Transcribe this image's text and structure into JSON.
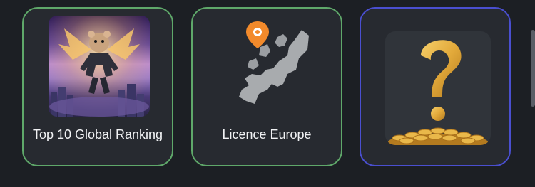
{
  "cards": [
    {
      "label": "Top 10 Global Ranking",
      "image": "hamster-astronaut-illustration",
      "border_color": "#5fa86a"
    },
    {
      "label": "Licence Europe",
      "image": "europe-map-with-pin",
      "border_color": "#5fa86a"
    },
    {
      "label": "",
      "image": "question-mark-with-coins",
      "border_color": "#4a4fd0"
    }
  ],
  "colors": {
    "background": "#1c1f24",
    "card": "#272a30",
    "text": "#f1f2f4",
    "pin": "#f28a2b",
    "map": "#a8abae",
    "gold": "#e2a93a"
  }
}
